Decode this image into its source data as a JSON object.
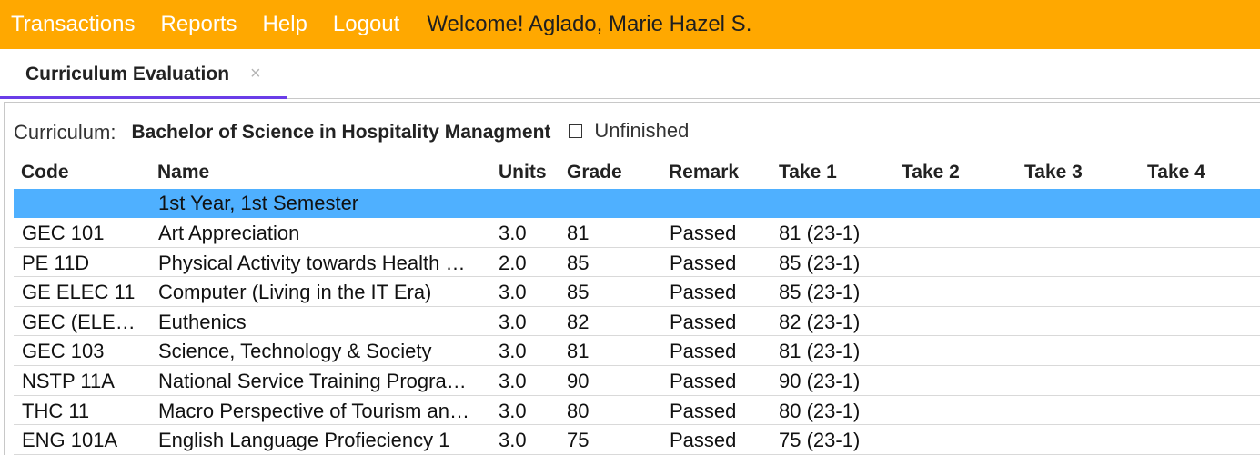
{
  "topbar": {
    "menu": [
      "Transactions",
      "Reports",
      "Help",
      "Logout"
    ],
    "welcome": "Welcome! Aglado, Marie Hazel S."
  },
  "tabs": [
    {
      "label": "Curriculum Evaluation",
      "close": "×"
    }
  ],
  "curriculum": {
    "label": "Curriculum:",
    "name": "Bachelor of Science in Hospitality Managment",
    "checkbox_label": "Unfinished",
    "checkbox_checked": false
  },
  "table": {
    "headers": [
      "Code",
      "Name",
      "Units",
      "Grade",
      "Remark",
      "Take 1",
      "Take 2",
      "Take 3",
      "Take 4"
    ],
    "semester": "1st Year, 1st Semester",
    "rows": [
      {
        "code": "GEC 101",
        "name": "Art Appreciation",
        "units": "3.0",
        "grade": "81",
        "remark": "Passed",
        "take1": "81 (23-1)",
        "take2": "",
        "take3": "",
        "take4": ""
      },
      {
        "code": "PE 11D",
        "name": "Physical Activity towards Health …",
        "units": "2.0",
        "grade": "85",
        "remark": "Passed",
        "take1": "85 (23-1)",
        "take2": "",
        "take3": "",
        "take4": ""
      },
      {
        "code": "GE ELEC 11",
        "name": "Computer (Living in the IT Era)",
        "units": "3.0",
        "grade": "85",
        "remark": "Passed",
        "take1": "85 (23-1)",
        "take2": "",
        "take3": "",
        "take4": ""
      },
      {
        "code": "GEC (ELE…",
        "name": "Euthenics",
        "units": "3.0",
        "grade": "82",
        "remark": "Passed",
        "take1": "82 (23-1)",
        "take2": "",
        "take3": "",
        "take4": ""
      },
      {
        "code": "GEC 103",
        "name": "Science, Technology & Society",
        "units": "3.0",
        "grade": "81",
        "remark": "Passed",
        "take1": "81 (23-1)",
        "take2": "",
        "take3": "",
        "take4": ""
      },
      {
        "code": "NSTP 11A",
        "name": "National Service Training Progra…",
        "units": "3.0",
        "grade": "90",
        "remark": "Passed",
        "take1": "90 (23-1)",
        "take2": "",
        "take3": "",
        "take4": ""
      },
      {
        "code": "THC 11",
        "name": "Macro Perspective of Tourism an…",
        "units": "3.0",
        "grade": "80",
        "remark": "Passed",
        "take1": "80 (23-1)",
        "take2": "",
        "take3": "",
        "take4": ""
      },
      {
        "code": "ENG 101A",
        "name": "English Language Profieciency 1",
        "units": "3.0",
        "grade": "75",
        "remark": "Passed",
        "take1": "75 (23-1)",
        "take2": "",
        "take3": "",
        "take4": ""
      }
    ]
  },
  "colors": {
    "topbar": "#ffa800",
    "semester_row": "#4fb0ff",
    "tab_underline": "#6a3de8"
  }
}
